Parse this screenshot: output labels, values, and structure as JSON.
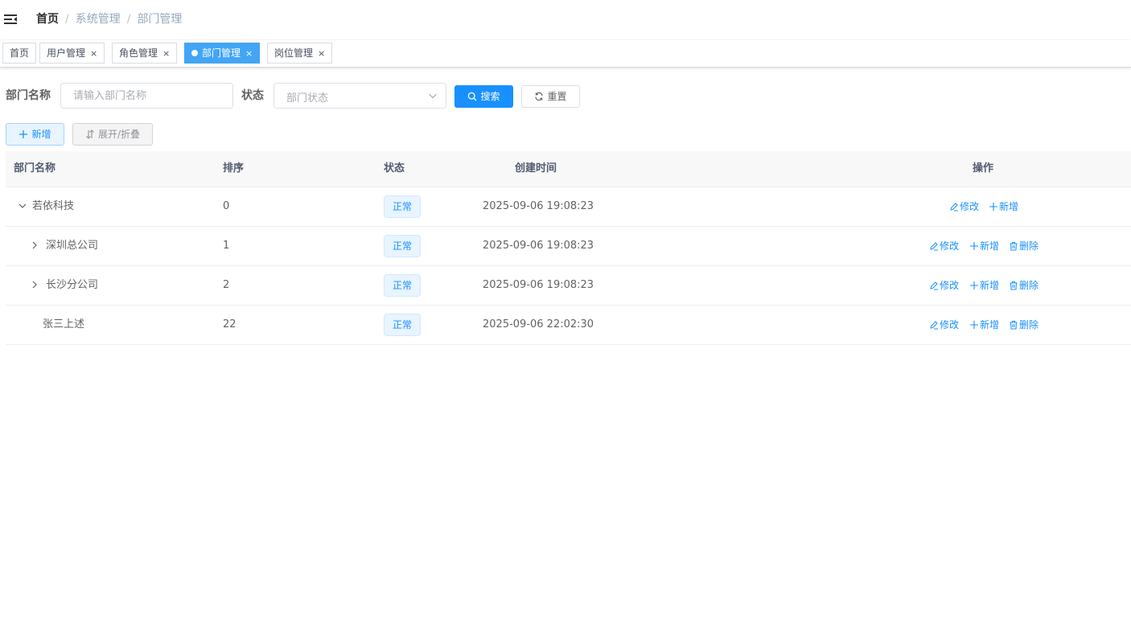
{
  "breadcrumb": {
    "home": "首页",
    "level1": "系统管理",
    "level2": "部门管理",
    "separator": "/"
  },
  "tags": [
    {
      "label": "首页",
      "closable": false,
      "active": false
    },
    {
      "label": "用户管理",
      "closable": true,
      "active": false
    },
    {
      "label": "角色管理",
      "closable": true,
      "active": false
    },
    {
      "label": "部门管理",
      "closable": true,
      "active": true
    },
    {
      "label": "岗位管理",
      "closable": true,
      "active": false
    }
  ],
  "tag_close_glyph": "×",
  "search": {
    "dept_name_label": "部门名称",
    "dept_name_placeholder": "请输入部门名称",
    "status_label": "状态",
    "status_placeholder": "部门状态",
    "search_button": "搜索",
    "reset_button": "重置"
  },
  "toolbar": {
    "add_button": "新增",
    "expand_button": "展开/折叠"
  },
  "table": {
    "columns": [
      "部门名称",
      "排序",
      "状态",
      "创建时间",
      "操作"
    ],
    "rows": [
      {
        "name": "若依科技",
        "order": "0",
        "status": "正常",
        "created": "2025-09-06 19:08:23",
        "expand": "expanded",
        "ops": [
          "修改",
          "新增"
        ]
      },
      {
        "name": "深圳总公司",
        "order": "1",
        "status": "正常",
        "created": "2025-09-06 19:08:23",
        "expand": "collapsed",
        "ops": [
          "修改",
          "新增",
          "删除"
        ]
      },
      {
        "name": "长沙分公司",
        "order": "2",
        "status": "正常",
        "created": "2025-09-06 19:08:23",
        "expand": "collapsed",
        "ops": [
          "修改",
          "新增",
          "删除"
        ]
      },
      {
        "name": "张三上述",
        "order": "22",
        "status": "正常",
        "created": "2025-09-06 22:02:30",
        "expand": "none",
        "ops": [
          "修改",
          "新增",
          "删除"
        ]
      }
    ]
  },
  "colors": {
    "primary": "#1890ff",
    "active_tag": "#42a5f5",
    "header_bg": "#f8f8f9"
  },
  "icons": {
    "menu": "hamburger-icon",
    "search": "search-icon",
    "reset": "refresh-icon",
    "add": "plus-icon",
    "sort": "sort-icon",
    "edit": "edit-icon",
    "delete": "delete-icon"
  }
}
